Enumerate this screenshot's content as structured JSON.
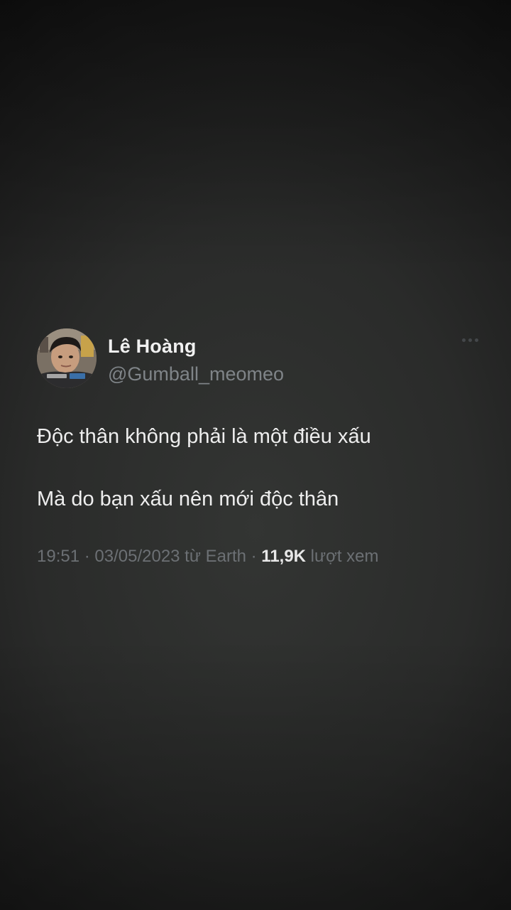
{
  "tweet": {
    "author": {
      "display_name": "Lê Hoàng",
      "handle": "@Gumball_meomeo",
      "avatar_icon": "profile-photo"
    },
    "more_icon": "more-horizontal-icon",
    "body": {
      "line1": "Độc thân không phải là một điều xấu",
      "line2": "Mà do bạn xấu nên mới độc thân"
    },
    "meta": {
      "time": "19:51",
      "separator": " · ",
      "date": "03/05/2023",
      "source_prefix": " từ ",
      "source": "Earth",
      "views_count": "11,9K",
      "views_label": " lượt xem"
    }
  },
  "colors": {
    "background": "#2b2c2b",
    "name": "#f1f1f1",
    "handle": "#7f8488",
    "body_text": "#eeeeee",
    "meta_text": "#6c7074"
  }
}
